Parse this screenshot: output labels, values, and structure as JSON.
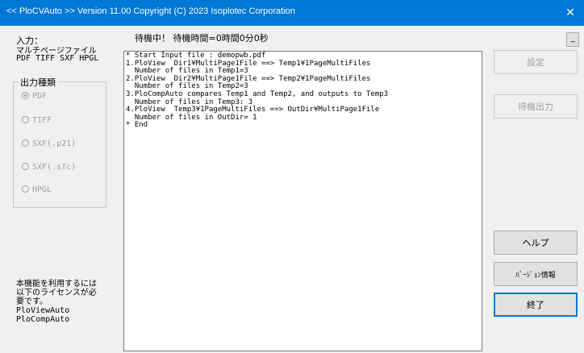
{
  "window": {
    "title": "<< PloCVAuto >>  Version 11.00 Copyright (C) 2023 Isoplotec Corporation",
    "close_glyph": "✕"
  },
  "left_panel": {
    "input_label": "入力：",
    "input_desc": "マルチページファイル",
    "input_formats": "PDF TIFF SXF HPGL",
    "output_group": {
      "legend": "出力種類",
      "options": [
        {
          "label": "PDF",
          "selected": true
        },
        {
          "label": "TIFF",
          "selected": false
        },
        {
          "label": "SXF(.p21)",
          "selected": false
        },
        {
          "label": "SXF(.sfc)",
          "selected": false
        },
        {
          "label": "HPGL",
          "selected": false
        }
      ]
    },
    "license_note_line1": "本機能を利用するには",
    "license_note_line2": "以下のライセンスが必",
    "license_note_line3": "要です。",
    "license_item1": "PloViewAuto",
    "license_item2": "PloCompAuto"
  },
  "status": {
    "text": "待機中！  待機時間=0時間0分0秒",
    "minimize_label": "_"
  },
  "log": {
    "lines": [
      "* Start Input file : demopwb.pdf",
      "1.PloView  Dir1¥MultiPage1File ==> Temp1¥1PageMultiFiles",
      "  Number of files in Temp1=3",
      "2.PloView  Dir2¥MultiPage1File ==> Temp2¥1PageMultiFiles",
      "  Number of files in Temp2=3",
      "3.PloCompAuto compares Temp1 and Temp2, and outputs to Temp3",
      "  Number of files in Temp3: 3",
      "4.PloView  Temp3¥1PageMultiFiles ==> OutDir¥MultiPage1File",
      "  Number of files in OutDir= 1",
      "* End"
    ]
  },
  "buttons": {
    "settings": "設定",
    "standby_output": "待機出力",
    "help": "ヘルプ",
    "version_info": "ﾊﾞｰｼﾞｮﾝ情報",
    "exit": "終了"
  }
}
